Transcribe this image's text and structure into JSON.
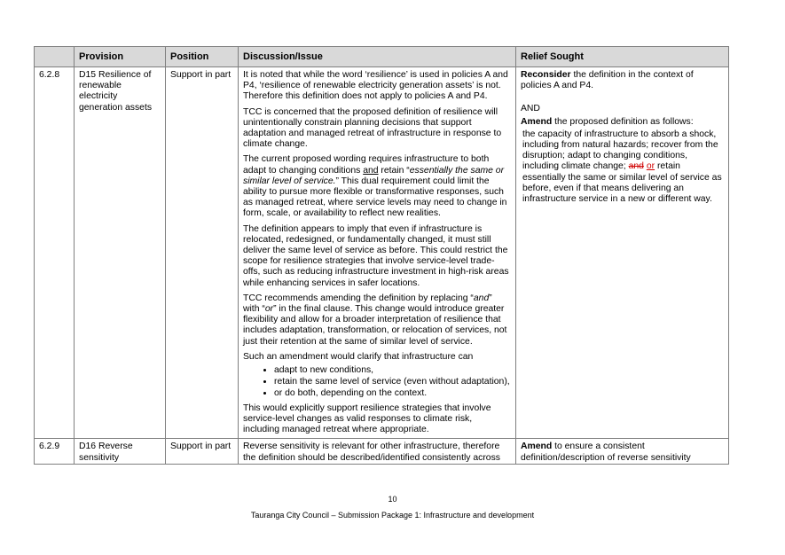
{
  "table": {
    "headers": [
      "",
      "Provision",
      "Position",
      "Discussion/Issue",
      "Relief Sought"
    ],
    "row1": {
      "ref": "6.2.8",
      "provision": "D15 Resilience of renewable electricity generation assets",
      "position": "Support in part",
      "d1": "It is noted that while the word ‘resilience’ is used in policies A and P4, ‘resilience of renewable electricity generation assets’ is not. Therefore this definition does not apply to policies A and P4.",
      "d2": "TCC is concerned that the proposed definition of resilience will unintentionally constrain planning decisions that support adaptation and managed retreat of infrastructure in response to climate change.",
      "d3a": "The current proposed wording requires infrastructure to both adapt to changing conditions ",
      "d3b": "and",
      "d3c": " retain “",
      "d3d": "essentially the same or similar level of service.",
      "d3e": "” This dual requirement could limit the ability to pursue more flexible or transformative responses, such as managed retreat, where service levels may need to change in form, scale, or availability to reflect new realities.",
      "d4": "The definition appears to imply that even if infrastructure is relocated, redesigned, or fundamentally changed, it must still deliver the same level of service as before. This could restrict the scope for resilience strategies that involve service-level trade-offs, such as reducing infrastructure investment in high-risk areas while enhancing services in safer locations.",
      "d5a": "TCC recommends amending the definition by replacing “",
      "d5b": "and",
      "d5c": "” with “",
      "d5d": "or",
      "d5e": "” in the final clause. This change would introduce greater flexibility and allow for a broader interpretation of resilience that includes adaptation, transformation, or relocation of services, not just their retention at the same of similar level of service.",
      "d6": "Such an amendment would clarify that infrastructure can",
      "bullets": [
        "adapt to new conditions,",
        "retain the same level of service (even without adaptation),",
        "or do both, depending on the context."
      ],
      "d7": "This would explicitly support resilience strategies that involve service-level changes as valid responses to climate risk, including managed retreat where appropriate.",
      "r1_bold": "Reconsider",
      "r1_rest": " the definition in the context of policies A and P4.",
      "r_and": "AND",
      "r2_bold": "Amend",
      "r2_rest": " the proposed definition as follows:",
      "r3a": "the capacity of infrastructure to absorb a shock, including from natural hazards; recover from the disruption; adapt to changing conditions, including climate change; ",
      "r3_del": "and",
      "r3_ins": "or",
      "r3b": " retain essentially the same or similar level of service as before, even if that means delivering an infrastructure service in a new or different way."
    },
    "row2": {
      "ref": "6.2.9",
      "provision": "D16 Reverse sensitivity",
      "position": "Support in part",
      "discussion": "Reverse sensitivity is relevant for other infrastructure, therefore the definition should be described/identified consistently across",
      "r_bold": "Amend",
      "r_rest": " to ensure a consistent definition/description of reverse sensitivity"
    }
  },
  "page_number": "10",
  "footer": "Tauranga City Council – Submission Package 1: Infrastructure and development"
}
